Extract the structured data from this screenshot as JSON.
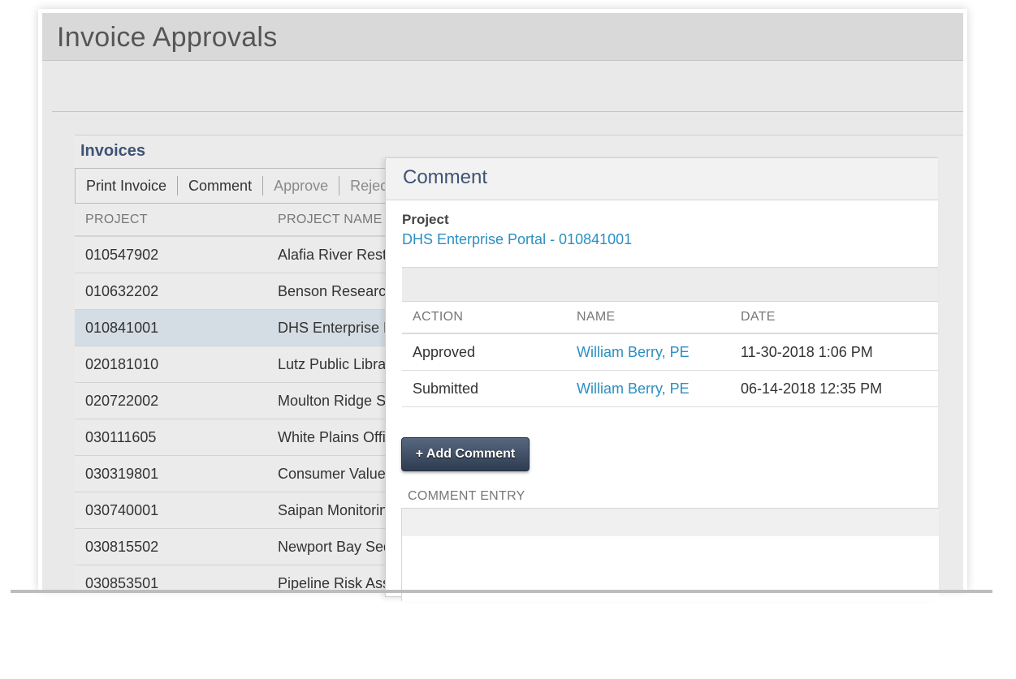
{
  "header": {
    "title": "Invoice Approvals"
  },
  "invoices": {
    "title": "Invoices",
    "toolbar": {
      "print_label": "Print Invoice",
      "comment_label": "Comment",
      "approve_label": "Approve",
      "reject_label": "Reject"
    },
    "columns": {
      "project": "PROJECT",
      "project_name": "PROJECT NAME"
    },
    "rows": [
      {
        "project": "010547902",
        "name": "Alafia River Restoration"
      },
      {
        "project": "010632202",
        "name": "Benson Research Lab E"
      },
      {
        "project": "010841001",
        "name": "DHS Enterprise Portal"
      },
      {
        "project": "020181010",
        "name": "Lutz Public Library"
      },
      {
        "project": "020722002",
        "name": "Moulton Ridge Security"
      },
      {
        "project": "030111605",
        "name": "White Plains Office Park"
      },
      {
        "project": "030319801",
        "name": "Consumer Value Stores"
      },
      {
        "project": "030740001",
        "name": "Saipan Monitoring Stud"
      },
      {
        "project": "030815502",
        "name": "Newport Bay Sediment"
      },
      {
        "project": "030853501",
        "name": "Pipeline Risk Assessme"
      }
    ],
    "selected_row": 2
  },
  "comment_panel": {
    "title": "Comment",
    "project_label": "Project",
    "project_value": "DHS Enterprise Portal - 010841001",
    "history": {
      "columns": {
        "action": "ACTION",
        "name": "NAME",
        "date": "DATE"
      },
      "rows": [
        {
          "action": "Approved",
          "name": "William Berry, PE",
          "date": "11-30-2018 1:06 PM"
        },
        {
          "action": "Submitted",
          "name": "William Berry, PE",
          "date": "06-14-2018 12:35 PM"
        }
      ]
    },
    "add_comment_label": "+ Add Comment",
    "entry_label": "COMMENT ENTRY"
  }
}
